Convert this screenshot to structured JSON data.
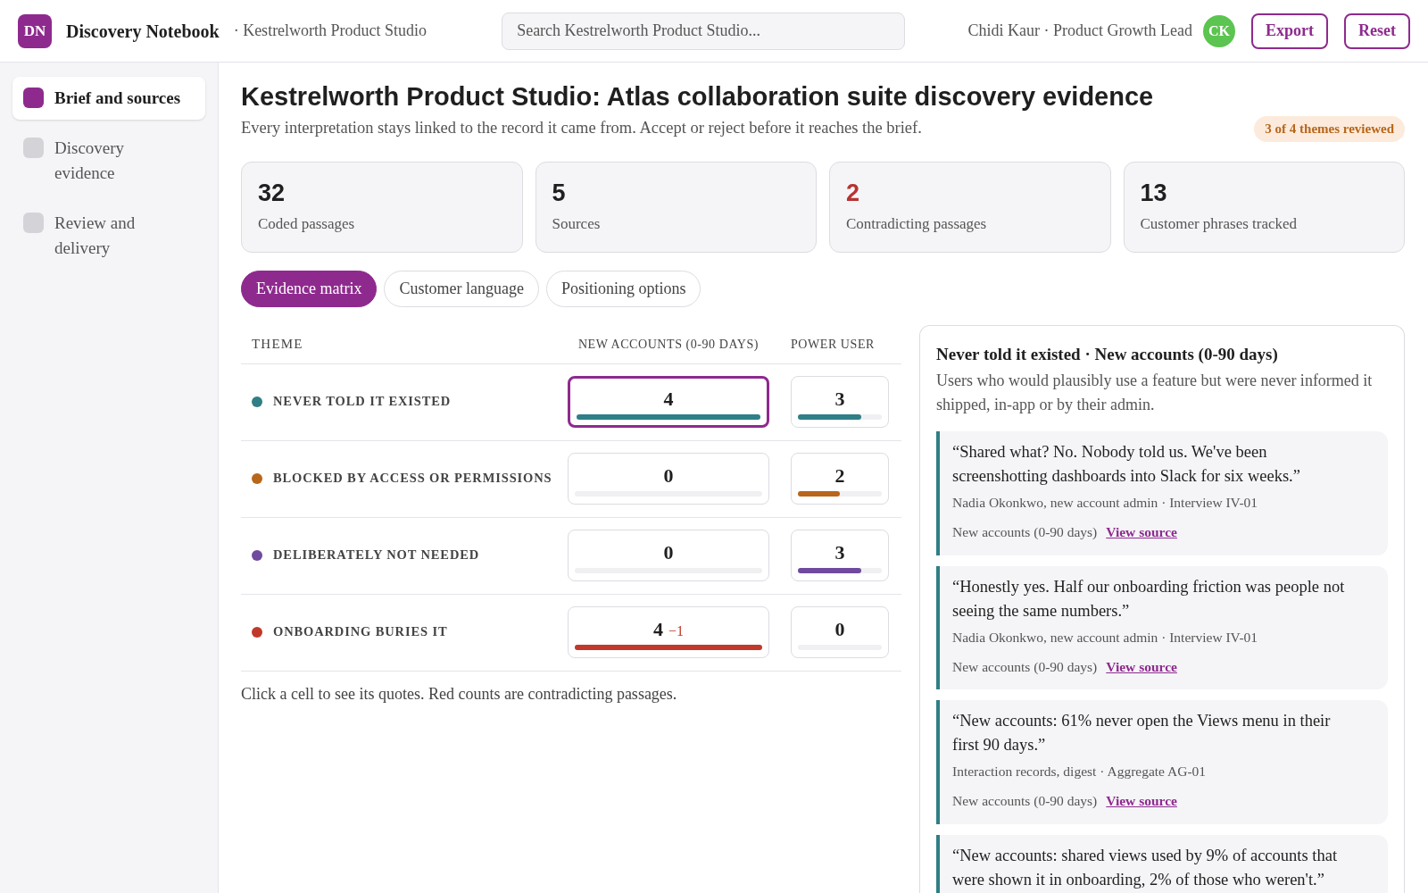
{
  "header": {
    "logo": "DN",
    "app_title": "Discovery Notebook",
    "workspace": "· Kestrelworth Product Studio",
    "search": {
      "placeholder": "Search Kestrelworth Product Studio..."
    },
    "user": "Chidi Kaur · Product Growth Lead",
    "avatar": "CK",
    "buttons": [
      "Export",
      "Reset"
    ]
  },
  "sidebar": {
    "items": [
      {
        "label": "Brief and sources",
        "selected": true
      },
      {
        "label": "Discovery evidence",
        "selected": false
      },
      {
        "label": "Review and delivery",
        "selected": false
      }
    ]
  },
  "page": {
    "title": "Kestrelworth Product Studio: Atlas collaboration suite discovery evidence",
    "subtitle": "Every interpretation stays linked to the record it came from. Accept or reject before it reaches the brief.",
    "badge": "3 of 4 themes reviewed"
  },
  "stats": [
    {
      "value": "32",
      "label": "Coded passages",
      "kind": "plain"
    },
    {
      "value": "5",
      "label": "Sources",
      "kind": "plain"
    },
    {
      "value": "2",
      "label": "Contradicting passages",
      "kind": "alert"
    },
    {
      "value": "13",
      "label": "Customer phrases tracked",
      "kind": "plain"
    }
  ],
  "tabs": [
    {
      "label": "Evidence matrix",
      "selected": true
    },
    {
      "label": "Customer language",
      "selected": false
    },
    {
      "label": "Positioning options",
      "selected": false
    }
  ],
  "matrix": {
    "theme_header": "THEME",
    "columns": [
      "NEW ACCOUNTS (0-90 DAYS)",
      "POWER USER"
    ],
    "rows": [
      {
        "theme": "NEVER TOLD IT EXISTED",
        "color": "#2f7f86",
        "cells": [
          {
            "count": "4",
            "level": 1,
            "selected": true
          },
          {
            "count": "3",
            "level": 0.75,
            "selected": false
          }
        ]
      },
      {
        "theme": "BLOCKED BY ACCESS OR PERMISSIONS",
        "color": "#b8661b",
        "cells": [
          {
            "count": "0",
            "selected": false
          },
          {
            "count": "2",
            "level": 0.5,
            "selected": false
          }
        ]
      },
      {
        "theme": "DELIBERATELY NOT NEEDED",
        "color": "#6f4a9e",
        "cells": [
          {
            "count": "0",
            "selected": false
          },
          {
            "count": "3",
            "level": 0.75,
            "selected": false
          }
        ]
      },
      {
        "theme": "ONBOARDING BURIES IT",
        "color": "#c0392b",
        "cells": [
          {
            "count": "4",
            "contradicting": "−1",
            "level": 1,
            "selected": false
          },
          {
            "count": "0",
            "selected": false
          }
        ]
      }
    ],
    "footnote": "Click a cell to see its quotes. Red counts are contradicting passages."
  },
  "detail": {
    "title": "Never told it existed · New accounts (0-90 days)",
    "description": "Users who would plausibly use a feature but were never informed it shipped, in-app or by their admin.",
    "quotes": [
      {
        "text": "“Shared what? No. Nobody told us. We've been screenshotting dashboards into Slack for six weeks.”",
        "attribution": "Nadia Okonkwo, new account admin · Interview IV-01",
        "segment": "New accounts (0-90 days)",
        "link": "View source"
      },
      {
        "text": "“Honestly yes. Half our onboarding friction was people not seeing the same numbers.”",
        "attribution": "Nadia Okonkwo, new account admin · Interview IV-01",
        "segment": "New accounts (0-90 days)",
        "link": "View source"
      },
      {
        "text": "“New accounts: 61% never open the Views menu in their first 90 days.”",
        "attribution": "Interaction records, digest · Aggregate AG-01",
        "segment": "New accounts (0-90 days)",
        "link": "View source"
      },
      {
        "text": "“New accounts: shared views used by 9% of accounts that were shown it in onboarding, 2% of those who weren't.”"
      }
    ]
  }
}
